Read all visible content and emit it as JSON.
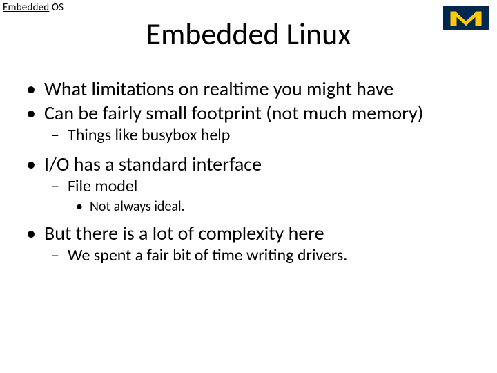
{
  "header": {
    "label_underlined": "Embedded",
    "label_rest": " OS",
    "logo_alt": "University of Michigan logo"
  },
  "title": "Embedded Linux",
  "bullets": {
    "b1": "What limitations on realtime you might have",
    "b2": "Can be fairly small footprint (not much memory)",
    "b2_1": "Things like busybox help",
    "b3": "I/O has a standard interface",
    "b3_1": "File model",
    "b3_1_1": "Not always ideal.",
    "b4": "But there is a lot of complexity here",
    "b4_1": "We spent a fair bit of time writing drivers."
  }
}
